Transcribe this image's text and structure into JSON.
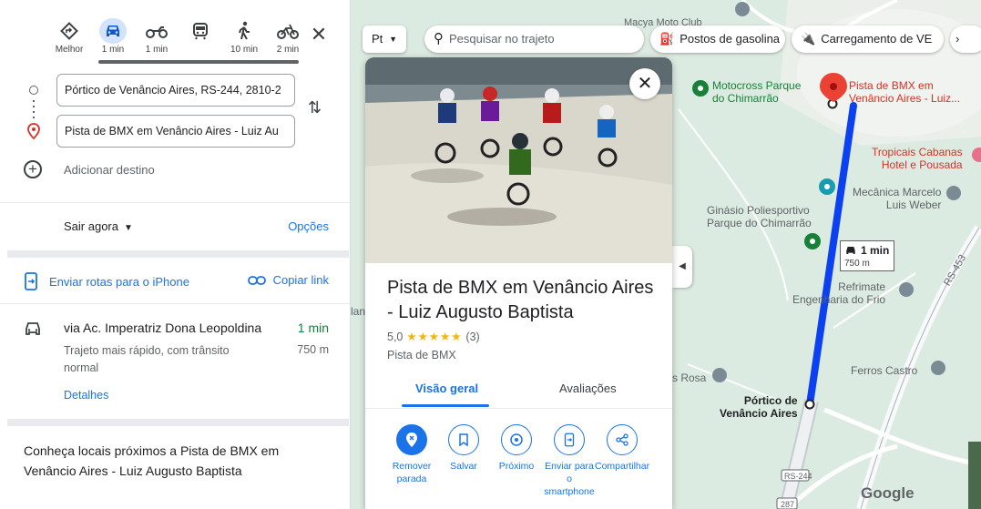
{
  "modes": [
    {
      "name": "Melhor",
      "time": ""
    },
    {
      "name": "",
      "time": "1 min"
    },
    {
      "name": "",
      "time": "1 min"
    },
    {
      "name": "",
      "time": ""
    },
    {
      "name": "",
      "time": "10 min"
    },
    {
      "name": "",
      "time": "2 min"
    }
  ],
  "directions": {
    "origin": "Pórtico de Venâncio Aires, RS-244, 2810-2",
    "destination": "Pista de BMX em Venâncio Aires - Luiz Au",
    "add_destination": "Adicionar destino",
    "leave_now": "Sair agora",
    "options": "Opções",
    "send_to_phone": "Enviar rotas para o iPhone",
    "copy_link": "Copiar link"
  },
  "route": {
    "title": "via Ac. Imperatriz Dona Leopoldina",
    "time": "1 min",
    "description": "Trajeto mais rápido, com trânsito normal",
    "distance": "750 m",
    "details": "Detalhes"
  },
  "nearby_title": "Conheça locais próximos a Pista de BMX em Venâncio Aires - Luiz Augusto Baptista",
  "map": {
    "layer_button": "Pt",
    "search_placeholder": "Pesquisar no trajeto",
    "chips": [
      "Postos de gasolina",
      "Carregamento de VE"
    ],
    "labels": {
      "motocross": "Motocross Parque\ndo Chimarrão",
      "pista": "Pista de BMX em\nVenâncio Aires - Luiz...",
      "tropicais": "Tropicais Cabanas\nHotel e Pousada",
      "mecanica": "Mecânica Marcelo\nLuis Weber",
      "ginasio": "Ginásio Poliesportivo\nParque do Chimarrão",
      "refrimate": "Refrimate\nEngenharia do Frio",
      "ferros": "Ferros Castro",
      "rosa": "s Rosa",
      "portico": "Pórtico de\nVenâncio Aires",
      "rs453": "RS-453",
      "rs244": "RS-244",
      "r287": "287",
      "lant": "lant",
      "top_partial": "Macya Moto Club",
      "google": "Google"
    },
    "route_badge": {
      "time": "1 min",
      "dist": "750 m"
    },
    "route_color": "#0b41f0"
  },
  "place": {
    "name": "Pista de BMX em Venâncio Aires - Luiz Augusto Baptista",
    "rating": "5,0",
    "stars": "★★★★★",
    "reviews": "(3)",
    "type": "Pista de BMX",
    "tabs": [
      "Visão geral",
      "Avaliações"
    ],
    "actions": [
      "Remover parada",
      "Salvar",
      "Próximo",
      "Enviar para o smartphone",
      "Compartilhar"
    ]
  }
}
